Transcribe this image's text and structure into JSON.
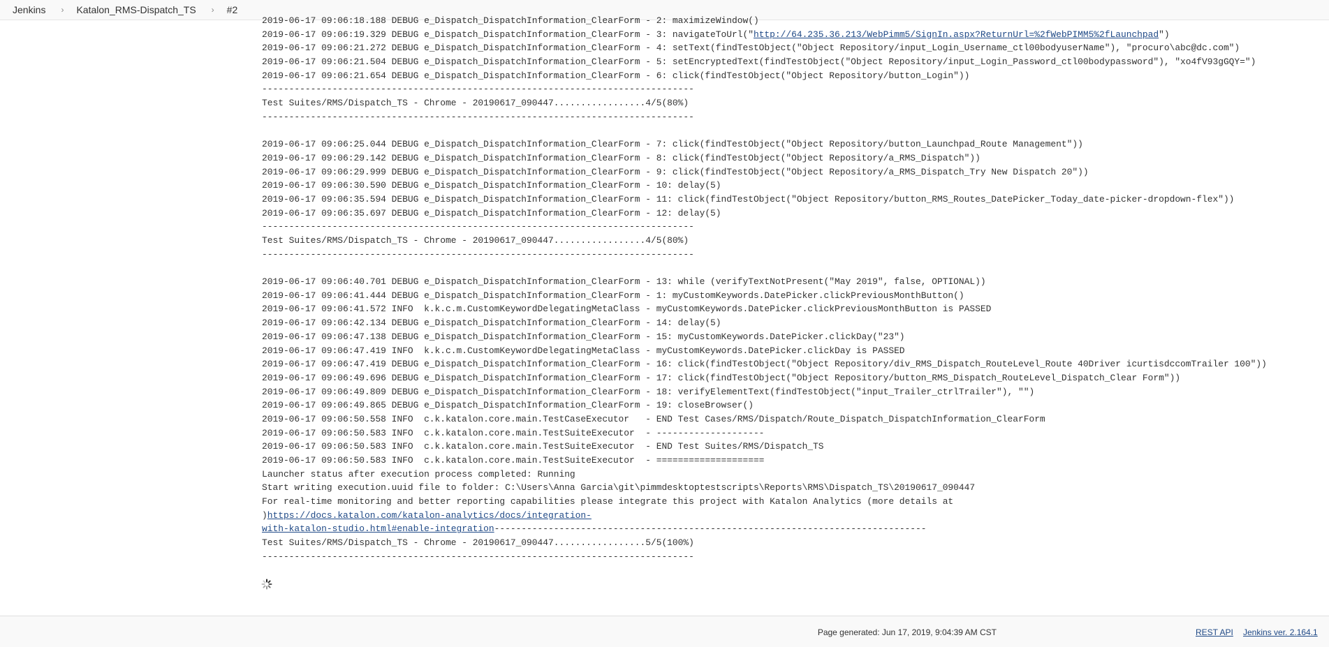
{
  "breadcrumb": {
    "items": [
      "Jenkins",
      "Katalon_RMS-Dispatch_TS",
      "#2"
    ],
    "separator": "›"
  },
  "console": {
    "lines": [
      "2019-06-17 09:06:18.188 DEBUG e_Dispatch_DispatchInformation_ClearForm - 2: maximizeWindow()",
      "2019-06-17 09:06:19.329 DEBUG e_Dispatch_DispatchInformation_ClearForm - 3: navigateToUrl(\"",
      "2019-06-17 09:06:21.272 DEBUG e_Dispatch_DispatchInformation_ClearForm - 4: setText(findTestObject(\"Object Repository/input_Login_Username_ctl00bodyuserName\"), \"procuro\\abc@dc.com\")",
      "2019-06-17 09:06:21.504 DEBUG e_Dispatch_DispatchInformation_ClearForm - 5: setEncryptedText(findTestObject(\"Object Repository/input_Login_Password_ctl00bodypassword\"), \"xo4fV93gGQY=\")",
      "2019-06-17 09:06:21.654 DEBUG e_Dispatch_DispatchInformation_ClearForm - 6: click(findTestObject(\"Object Repository/button_Login\"))",
      "--------------------------------------------------------------------------------",
      "Test Suites/RMS/Dispatch_TS - Chrome - 20190617_090447.................4/5(80%)",
      "--------------------------------------------------------------------------------",
      "",
      "2019-06-17 09:06:25.044 DEBUG e_Dispatch_DispatchInformation_ClearForm - 7: click(findTestObject(\"Object Repository/button_Launchpad_Route Management\"))",
      "2019-06-17 09:06:29.142 DEBUG e_Dispatch_DispatchInformation_ClearForm - 8: click(findTestObject(\"Object Repository/a_RMS_Dispatch\"))",
      "2019-06-17 09:06:29.999 DEBUG e_Dispatch_DispatchInformation_ClearForm - 9: click(findTestObject(\"Object Repository/a_RMS_Dispatch_Try New Dispatch 20\"))",
      "2019-06-17 09:06:30.590 DEBUG e_Dispatch_DispatchInformation_ClearForm - 10: delay(5)",
      "2019-06-17 09:06:35.594 DEBUG e_Dispatch_DispatchInformation_ClearForm - 11: click(findTestObject(\"Object Repository/button_RMS_Routes_DatePicker_Today_date-picker-dropdown-flex\"))",
      "2019-06-17 09:06:35.697 DEBUG e_Dispatch_DispatchInformation_ClearForm - 12: delay(5)",
      "--------------------------------------------------------------------------------",
      "Test Suites/RMS/Dispatch_TS - Chrome - 20190617_090447.................4/5(80%)",
      "--------------------------------------------------------------------------------",
      "",
      "2019-06-17 09:06:40.701 DEBUG e_Dispatch_DispatchInformation_ClearForm - 13: while (verifyTextNotPresent(\"May 2019\", false, OPTIONAL))",
      "2019-06-17 09:06:41.444 DEBUG e_Dispatch_DispatchInformation_ClearForm - 1: myCustomKeywords.DatePicker.clickPreviousMonthButton()",
      "2019-06-17 09:06:41.572 INFO  k.k.c.m.CustomKeywordDelegatingMetaClass - myCustomKeywords.DatePicker.clickPreviousMonthButton is PASSED",
      "2019-06-17 09:06:42.134 DEBUG e_Dispatch_DispatchInformation_ClearForm - 14: delay(5)",
      "2019-06-17 09:06:47.138 DEBUG e_Dispatch_DispatchInformation_ClearForm - 15: myCustomKeywords.DatePicker.clickDay(\"23\")",
      "2019-06-17 09:06:47.419 INFO  k.k.c.m.CustomKeywordDelegatingMetaClass - myCustomKeywords.DatePicker.clickDay is PASSED",
      "2019-06-17 09:06:47.419 DEBUG e_Dispatch_DispatchInformation_ClearForm - 16: click(findTestObject(\"Object Repository/div_RMS_Dispatch_RouteLevel_Route 40Driver icurtisdccomTrailer 100\"))",
      "2019-06-17 09:06:49.696 DEBUG e_Dispatch_DispatchInformation_ClearForm - 17: click(findTestObject(\"Object Repository/button_RMS_Dispatch_RouteLevel_Dispatch_Clear Form\"))",
      "2019-06-17 09:06:49.809 DEBUG e_Dispatch_DispatchInformation_ClearForm - 18: verifyElementText(findTestObject(\"input_Trailer_ctrlTrailer\"), \"\")",
      "2019-06-17 09:06:49.865 DEBUG e_Dispatch_DispatchInformation_ClearForm - 19: closeBrowser()",
      "2019-06-17 09:06:50.558 INFO  c.k.katalon.core.main.TestCaseExecutor   - END Test Cases/RMS/Dispatch/Route_Dispatch_DispatchInformation_ClearForm",
      "2019-06-17 09:06:50.583 INFO  c.k.katalon.core.main.TestSuiteExecutor  - --------------------",
      "2019-06-17 09:06:50.583 INFO  c.k.katalon.core.main.TestSuiteExecutor  - END Test Suites/RMS/Dispatch_TS",
      "2019-06-17 09:06:50.583 INFO  c.k.katalon.core.main.TestSuiteExecutor  - ====================",
      "Launcher status after execution process completed: Running",
      "Start writing execution.uuid file to folder: C:\\Users\\Anna Garcia\\git\\pimmdesktoptestscripts\\Reports\\RMS\\Dispatch_TS\\20190617_090447",
      "For real-time monitoring and better reporting capabilities please integrate this project with Katalon Analytics (more details at ",
      ")",
      "--------------------------------------------------------------------------------",
      "Test Suites/RMS/Dispatch_TS - Chrome - 20190617_090447.................5/5(100%)",
      "--------------------------------------------------------------------------------"
    ],
    "nav_url": "http://64.235.36.213/WebPimm5/SignIn.aspx?ReturnUrl=%2fWebPIMM5%2fLaunchpad",
    "nav_url_suffix": "\")",
    "analytics_link_line1": "https://docs.katalon.com/katalon-analytics/docs/integration-",
    "analytics_link_line2": "with-katalon-studio.html#enable-integration"
  },
  "footer": {
    "generated": "Page generated: Jun 17, 2019, 9:04:39 AM CST",
    "rest_api": "REST API",
    "version": "Jenkins ver. 2.164.1"
  },
  "colors": {
    "link": "#204a87",
    "text": "#333333",
    "bar_bg": "#f9f9f9"
  }
}
